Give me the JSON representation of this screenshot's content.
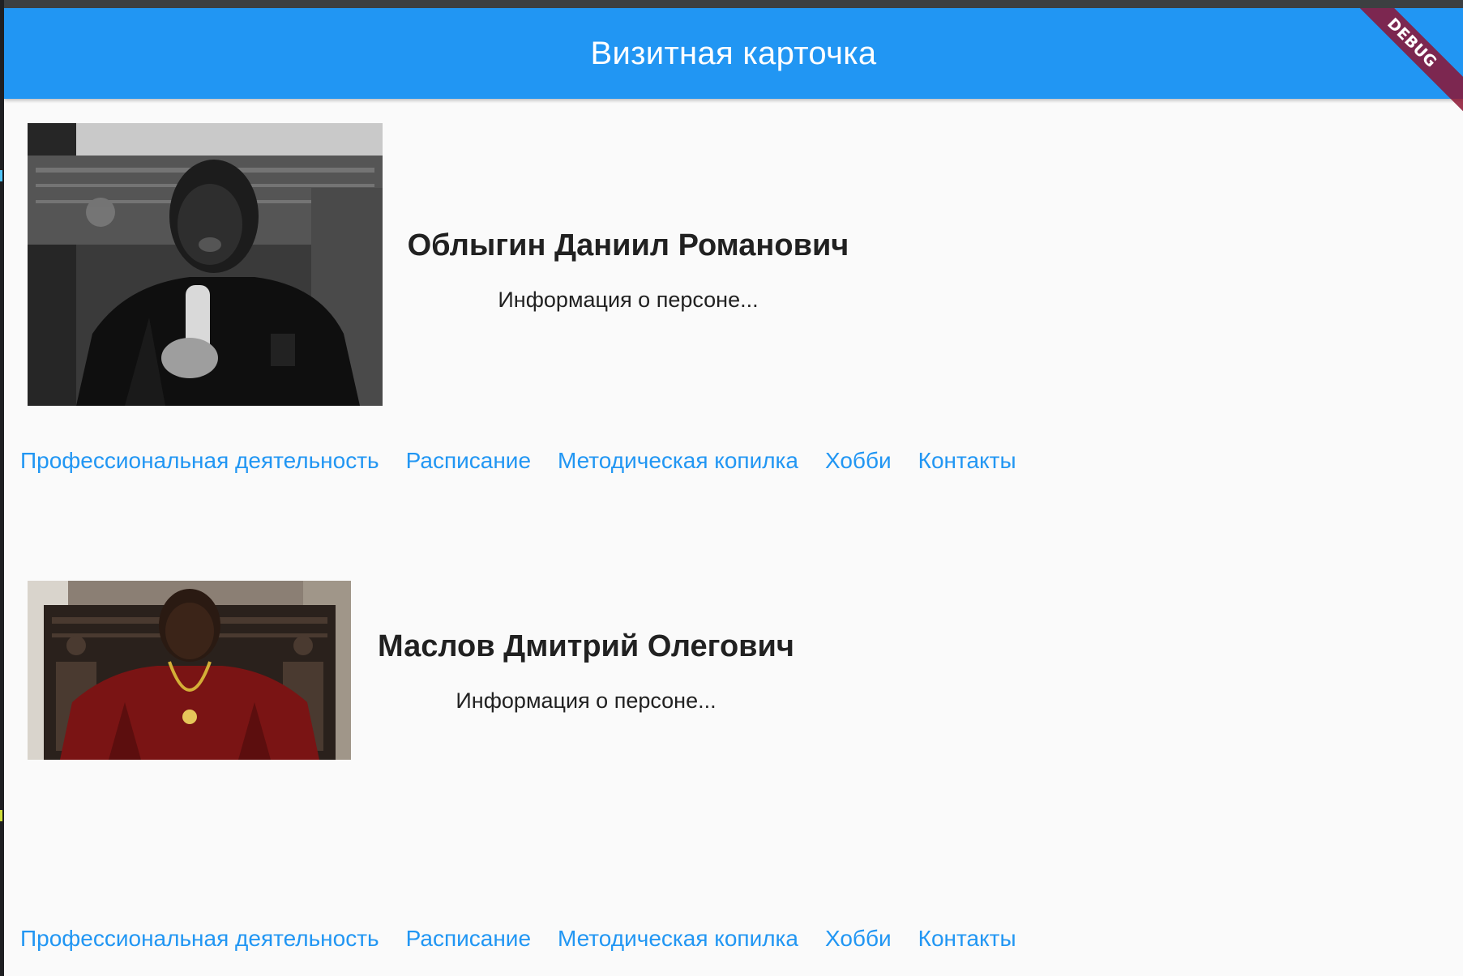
{
  "app": {
    "title": "Визитная карточка",
    "debug_banner": "DEBUG",
    "colors": {
      "appbar": "#2196f3",
      "link": "#2196f3",
      "background": "#fafafa",
      "text": "#212121",
      "banner": "#8c1432"
    }
  },
  "cards": [
    {
      "name": "Облыгин Даниил Романович",
      "description": "Информация о персоне...",
      "photo_icon": "person-photo-bw",
      "links": [
        "Профессиональная деятельность",
        "Расписание",
        "Методическая копилка",
        "Хобби",
        "Контакты"
      ]
    },
    {
      "name": "Маслов Дмитрий Олегович",
      "description": "Информация о персоне...",
      "photo_icon": "person-photo-color",
      "links": [
        "Профессиональная деятельность",
        "Расписание",
        "Методическая копилка",
        "Хобби",
        "Контакты"
      ]
    }
  ]
}
